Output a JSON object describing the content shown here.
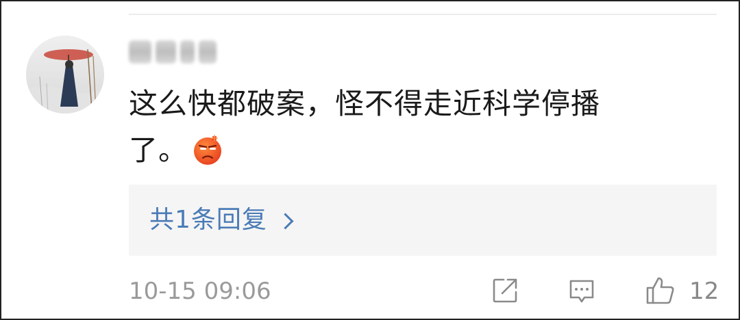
{
  "comment": {
    "avatar_icon": "avatar-ink-painting-figure-with-red-umbrella",
    "username": "",
    "text_line1": "这么快都破案，怪不得走近科学停播",
    "text_line2": "了。",
    "emoji_icon": "angry-face-emoji"
  },
  "replies": {
    "label": "共1条回复",
    "chevron_icon": "chevron-right-icon"
  },
  "meta": {
    "timestamp": "10-15 09:06",
    "like_count": "12"
  },
  "actions": {
    "share_icon": "share-icon",
    "reply_icon": "comment-icon",
    "like_icon": "thumbs-up-icon"
  },
  "colors": {
    "link": "#4a7bb6",
    "reply_box_bg": "#f5f5f5",
    "meta_text": "#9a9a9a",
    "emoji": "#f0572b"
  }
}
